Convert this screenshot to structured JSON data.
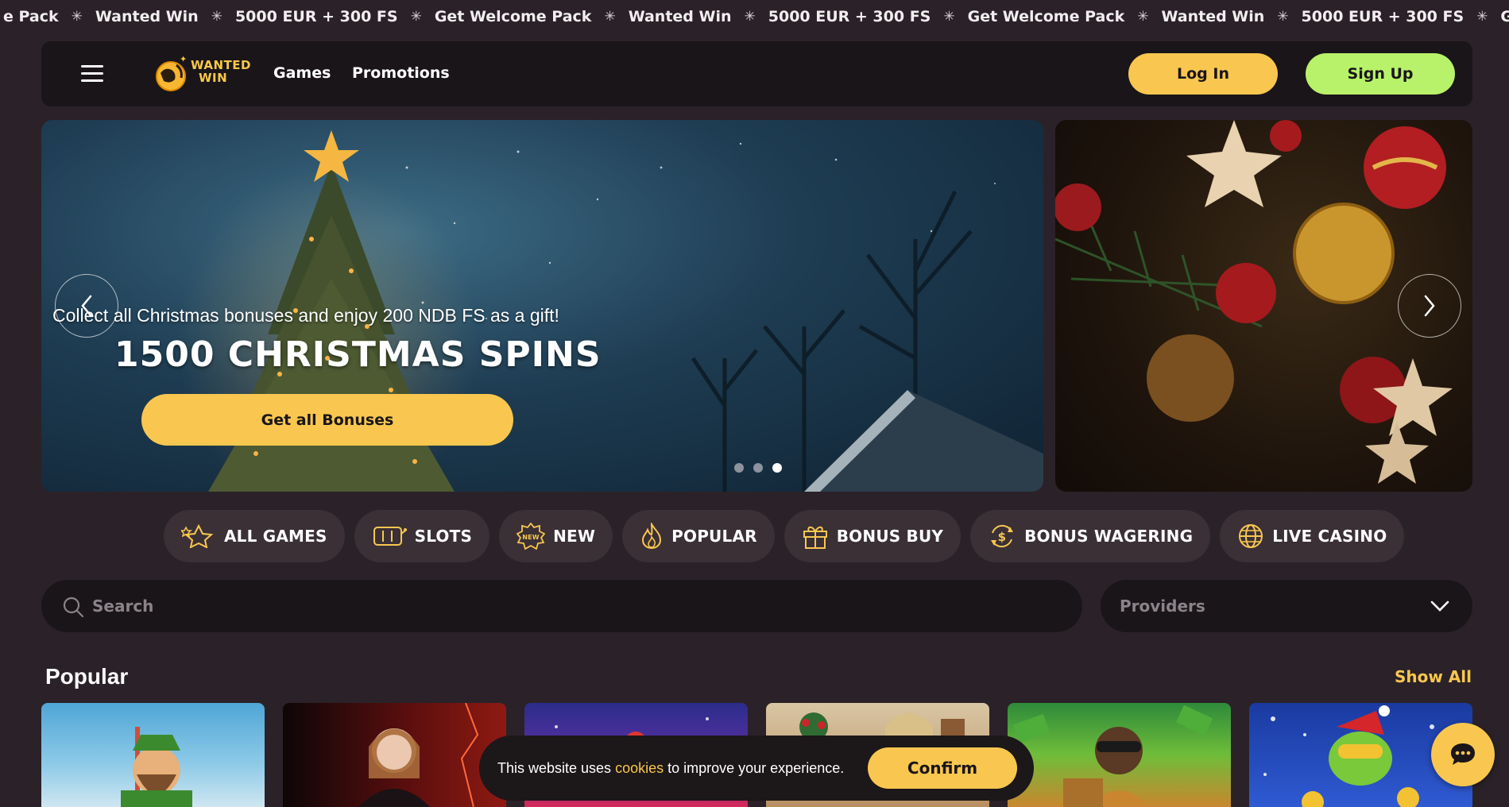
{
  "ticker": {
    "items": [
      "e Pack",
      "Wanted Win",
      "5000 EUR + 300 FS",
      "Get Welcome Pack",
      "Wanted Win",
      "5000 EUR + 300 FS",
      "Get Welcome Pack",
      "Wanted Win",
      "5000 EUR + 300 FS",
      "Get Welcome Pack"
    ],
    "separator": "✳"
  },
  "header": {
    "menu_icon": "hamburger-icon",
    "logo": {
      "line1": "WANTED",
      "line2": "WIN"
    },
    "nav": [
      {
        "label": "Games"
      },
      {
        "label": "Promotions"
      }
    ],
    "login_label": "Log In",
    "signup_label": "Sign Up"
  },
  "hero": {
    "subtitle": "Collect all Christmas bonuses and enjoy 200 NDB FS as a gift!",
    "title": "1500 CHRISTMAS SPINS",
    "cta_label": "Get all Bonuses",
    "slide_count": 3,
    "active_slide": 3,
    "prev_icon": "chevron-left-icon",
    "next_icon": "chevron-right-icon"
  },
  "categories": [
    {
      "label": "ALL GAMES",
      "icon": "stars-icon"
    },
    {
      "label": "SLOTS",
      "icon": "slot-machine-icon"
    },
    {
      "label": "NEW",
      "icon": "new-badge-icon"
    },
    {
      "label": "POPULAR",
      "icon": "fire-icon"
    },
    {
      "label": "BONUS BUY",
      "icon": "gift-icon"
    },
    {
      "label": "BONUS WAGERING",
      "icon": "dollar-cycle-icon"
    },
    {
      "label": "LIVE CASINO",
      "icon": "globe-icon"
    }
  ],
  "search": {
    "placeholder": "Search",
    "icon": "search-icon"
  },
  "providers": {
    "label": "Providers",
    "icon": "chevron-down-icon"
  },
  "popular": {
    "title": "Popular",
    "show_all_label": "Show All"
  },
  "cookie": {
    "text_before": "This website uses",
    "link_text": "cookies",
    "text_after": "to improve your experience.",
    "confirm_label": "Confirm"
  },
  "chat": {
    "icon": "chat-bubble-icon"
  },
  "colors": {
    "accent_yellow": "#f9c74f",
    "accent_green": "#b8f26a",
    "background": "#2a2228",
    "panel": "#1a1519"
  }
}
